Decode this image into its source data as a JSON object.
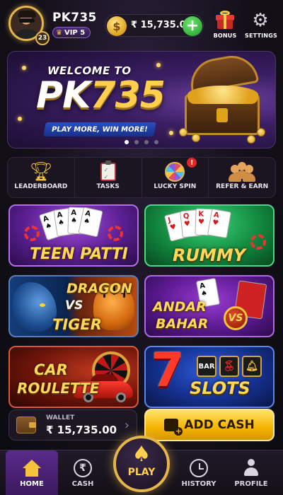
{
  "header": {
    "username": "PK735",
    "level": "23",
    "vip": "VIP 5",
    "balance": "₹ 15,735.00",
    "bonus_label": "BONUS",
    "settings_label": "SETTINGS"
  },
  "banner": {
    "welcome": "WELCOME TO",
    "brand_a": "PK",
    "brand_b": "735",
    "tagline": "PLAY MORE, WIN MORE!",
    "slide_count": 4,
    "active_slide": 1
  },
  "quick_actions": [
    {
      "label": "LEADERBOARD",
      "icon": "trophy-icon"
    },
    {
      "label": "TASKS",
      "icon": "clipboard-icon"
    },
    {
      "label": "LUCKY SPIN",
      "icon": "spin-wheel-icon",
      "badge": "!"
    },
    {
      "label": "REFER & EARN",
      "icon": "people-icon"
    }
  ],
  "games": {
    "teen_patti": "TEEN PATTI",
    "rummy": "RUMMY",
    "dragon_a": "DRAGON",
    "dragon_vs": "VS",
    "dragon_b": "TIGER",
    "andar_a": "ANDAR",
    "andar_b": "BAHAR",
    "andar_vs": "VS",
    "car_a": "CAR",
    "car_b": "ROULETTE",
    "slots_seven": "7",
    "slots": "SLOTS",
    "slots_reel_bar": "BAR"
  },
  "wallet": {
    "label": "WALLET",
    "amount": "₹ 15,735.00",
    "add_cash": "ADD CASH"
  },
  "nav": {
    "home": "HOME",
    "cash": "CASH",
    "play": "PLAY",
    "history": "HISTORY",
    "profile": "PROFILE"
  },
  "colors": {
    "gold": "#f5c23c",
    "accent_green": "#1e9c2b",
    "home_active": "#5a2a8a"
  }
}
